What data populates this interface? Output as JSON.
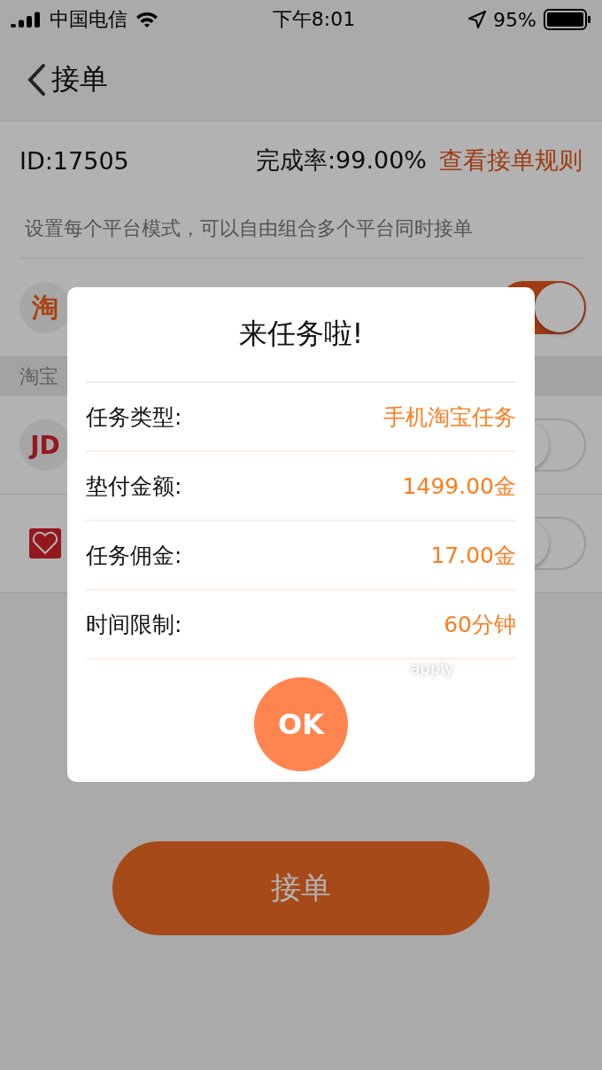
{
  "status_bar": {
    "carrier": "中国电信",
    "time": "下午8:01",
    "battery": "95%"
  },
  "nav": {
    "title": "接单"
  },
  "info": {
    "id": "ID:17505",
    "rate": "完成率:99.00%",
    "rules_link": "查看接单规则",
    "hint": "设置每个平台模式，可以自由组合多个平台同时接单"
  },
  "platforms": [
    {
      "kind": "taobao",
      "logo": "淘",
      "on": true,
      "section": "淘宝"
    },
    {
      "kind": "jd",
      "logo": "JD",
      "on": false
    },
    {
      "kind": "pdd",
      "on": false
    }
  ],
  "accept_button": "接单",
  "dialog": {
    "title": "来任务啦!",
    "rows": [
      {
        "label": "任务类型:",
        "value": "手机淘宝任务"
      },
      {
        "label": "垫付金额:",
        "value": "1499.00金"
      },
      {
        "label": "任务佣金:",
        "value": "17.00金"
      },
      {
        "label": "时间限制:",
        "value": "60分钟"
      }
    ],
    "faint_label": "apply",
    "ok": "OK"
  }
}
